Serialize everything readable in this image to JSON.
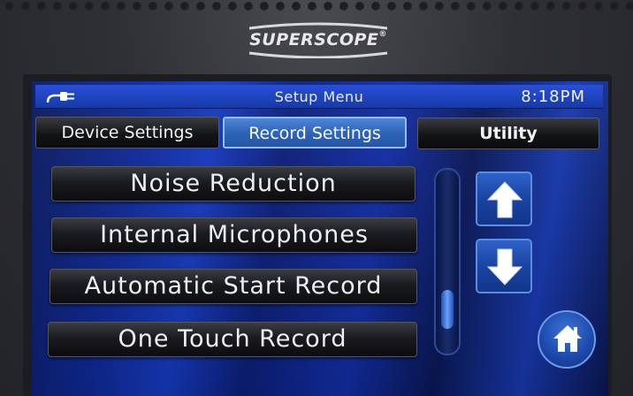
{
  "device": {
    "brand": "SUPERSCOPE",
    "brand_mark": "®"
  },
  "header": {
    "power_icon": "plug-icon",
    "title": "Setup Menu",
    "time": "8:18PM"
  },
  "tabs": [
    {
      "label": "Device Settings",
      "active": false
    },
    {
      "label": "Record Settings",
      "active": true
    },
    {
      "label": "Utility",
      "active": false
    }
  ],
  "menu": {
    "items": [
      {
        "label": "Noise Reduction"
      },
      {
        "label": "Internal Microphones"
      },
      {
        "label": "Automatic Start Record"
      },
      {
        "label": "One Touch Record"
      }
    ]
  },
  "scrollbar": {
    "position": 0.85
  },
  "nav": {
    "up_icon": "arrow-up-icon",
    "down_icon": "arrow-down-icon",
    "home_icon": "home-icon"
  },
  "colors": {
    "screen_blue": "#163bc2",
    "active_tab": "#2f64b8",
    "button_dark": "#141518"
  }
}
